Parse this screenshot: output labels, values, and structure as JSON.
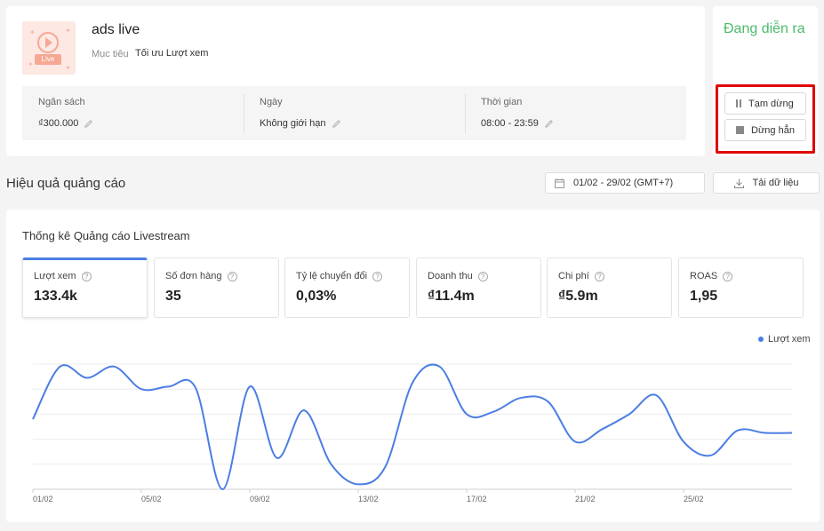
{
  "campaign": {
    "name": "ads live",
    "goal_label": "Mục tiêu",
    "goal_value": "Tối ưu Lượt xem",
    "thumb_tag": "Live",
    "info": [
      {
        "label": "Ngân sách",
        "value": "₫300.000"
      },
      {
        "label": "Ngày",
        "value": "Không giới hạn"
      },
      {
        "label": "Thời gian",
        "value": "08:00 - 23:59"
      }
    ]
  },
  "status": {
    "text": "Đang diễn ra",
    "pause_label": "Tạm dừng",
    "stop_label": "Dừng hẳn",
    "color": "#4cbb6c",
    "highlight_color": "#e00000"
  },
  "performance": {
    "title": "Hiệu quả quảng cáo",
    "date_range": "01/02 - 29/02 (GMT+7)",
    "download_label": "Tải dữ liệu"
  },
  "stats": {
    "title": "Thống kê Quảng cáo Livestream",
    "metrics": [
      {
        "label": "Lượt xem",
        "value": "133.4k"
      },
      {
        "label": "Số đơn hàng",
        "value": "35"
      },
      {
        "label": "Tỷ lệ chuyển đổi",
        "value": "0,03%"
      },
      {
        "label": "Doanh thu",
        "value": "₫11.4m"
      },
      {
        "label": "Chi phí",
        "value": "₫5.9m"
      },
      {
        "label": "ROAS",
        "value": "1,95"
      }
    ],
    "accent": "#4b7ee3"
  },
  "chart_data": {
    "type": "line",
    "title": "",
    "xlabel": "",
    "ylabel": "",
    "legend": "top-right",
    "grid": true,
    "series": [
      {
        "name": "Lượt xem",
        "color": "#4b7ee3",
        "x": [
          "01/02",
          "02/02",
          "03/02",
          "04/02",
          "05/02",
          "06/02",
          "07/02",
          "08/02",
          "09/02",
          "10/02",
          "11/02",
          "12/02",
          "13/02",
          "14/02",
          "15/02",
          "16/02",
          "17/02",
          "18/02",
          "19/02",
          "20/02",
          "21/02",
          "22/02",
          "23/02",
          "24/02",
          "25/02",
          "26/02",
          "27/02",
          "28/02",
          "29/02"
        ],
        "values": [
          0.56,
          0.98,
          0.89,
          0.98,
          0.8,
          0.82,
          0.81,
          0.0,
          0.82,
          0.25,
          0.63,
          0.2,
          0.04,
          0.18,
          0.85,
          0.98,
          0.6,
          0.62,
          0.73,
          0.7,
          0.38,
          0.48,
          0.6,
          0.75,
          0.38,
          0.27,
          0.47,
          0.45,
          0.45
        ]
      }
    ],
    "x_tick_labels": [
      "01/02",
      "05/02",
      "09/02",
      "13/02",
      "17/02",
      "21/02",
      "25/02"
    ]
  }
}
